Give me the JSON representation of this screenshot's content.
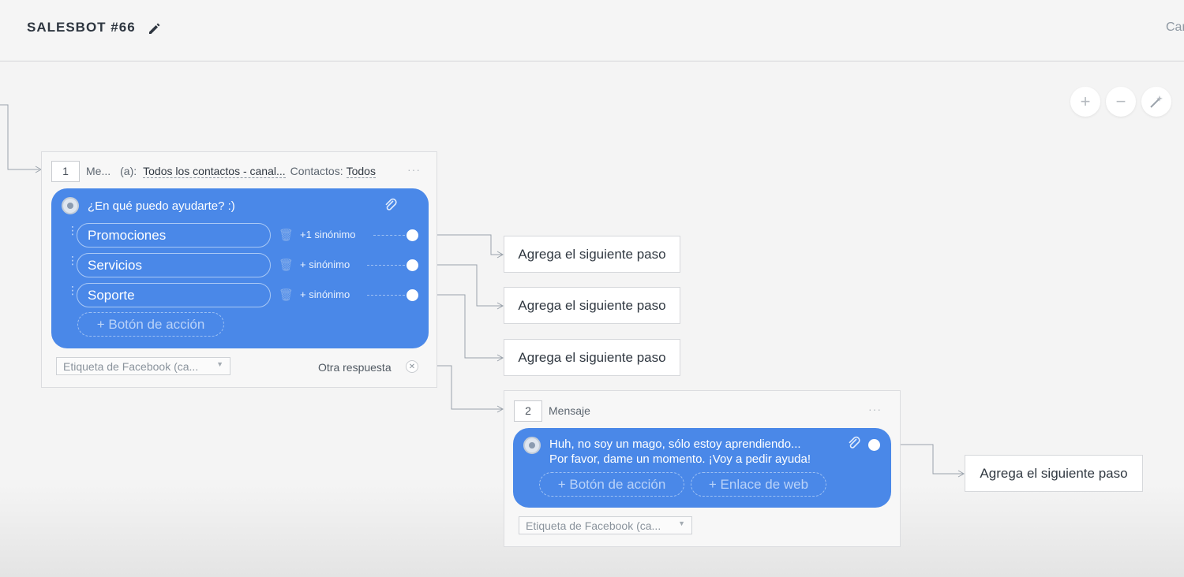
{
  "header": {
    "title": "SALESBOT #66",
    "cancel_label": "Car"
  },
  "toolbar": {
    "zoom_in": "+",
    "zoom_out": "−"
  },
  "step1": {
    "number": "1",
    "type_short": "Me...",
    "audience_prefix": "(a):",
    "audience": "Todos los contactos - canal...",
    "contacts_label": "Contactos:",
    "contacts_value": "Todos",
    "more": "···",
    "message": "¿En qué puedo ayudarte? :)",
    "options": [
      {
        "label": "Promociones",
        "synonym": "+1 sinónimo"
      },
      {
        "label": "Servicios",
        "synonym": "+ sinónimo"
      },
      {
        "label": "Soporte",
        "synonym": "+ sinónimo"
      }
    ],
    "add_action_button": "+ Botón de acción",
    "facebook_tag": "Etiqueta de Facebook (ca...",
    "other_answer": "Otra respuesta"
  },
  "step2": {
    "number": "2",
    "type": "Mensaje",
    "more": "···",
    "message_line1": "Huh, no soy un mago, sólo estoy aprendiendo...",
    "message_line2": "Por favor, dame un momento. ¡Voy a pedir ayuda!",
    "add_action_button": "+ Botón de acción",
    "web_link_button": "+ Enlace de web",
    "facebook_tag": "Etiqueta de Facebook (ca..."
  },
  "next_steps": [
    "Agrega el siguiente paso",
    "Agrega el siguiente paso",
    "Agrega el siguiente paso",
    "Agrega el siguiente paso"
  ],
  "colors": {
    "bubble": "#4a88e8",
    "canvas": "#f4f4f4",
    "text": "#313942"
  },
  "icons": [
    "pencil-icon",
    "plus-icon",
    "minus-icon",
    "magic-wand-icon",
    "bot-avatar-icon",
    "paperclip-icon",
    "trash-icon",
    "drag-handle-icon",
    "close-icon",
    "chevron-down-icon"
  ]
}
